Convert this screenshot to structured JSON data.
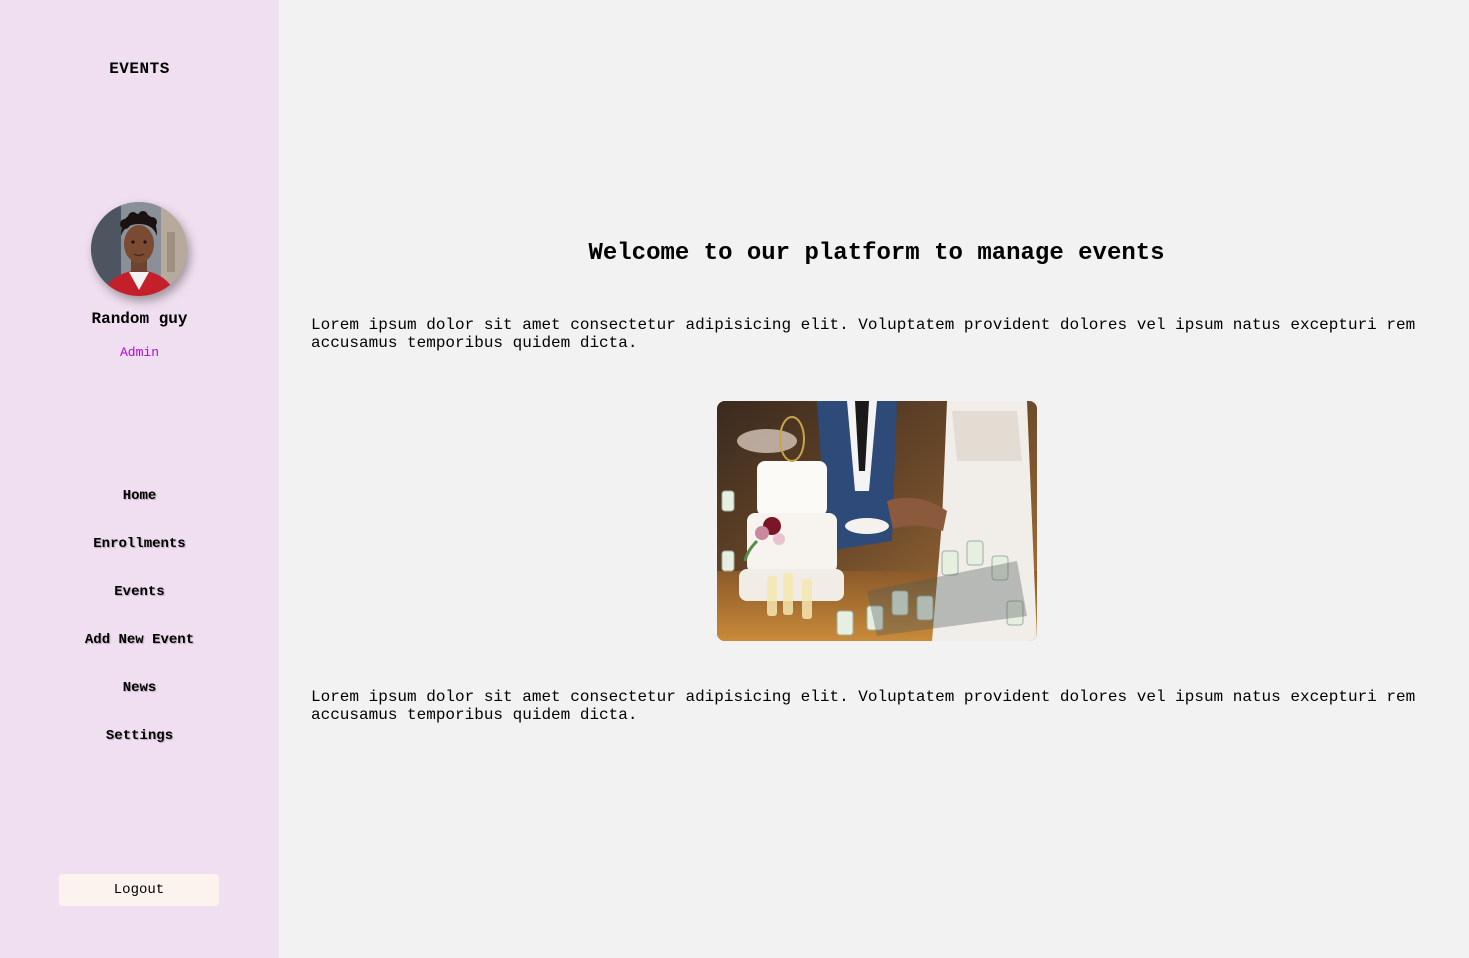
{
  "sidebar": {
    "brand": "EVENTS",
    "user": {
      "name": "Random guy",
      "role": "Admin"
    },
    "nav": [
      {
        "label": "Home"
      },
      {
        "label": "Enrollments"
      },
      {
        "label": "Events"
      },
      {
        "label": "Add New Event"
      },
      {
        "label": "News"
      },
      {
        "label": "Settings"
      }
    ],
    "logout_label": "Logout"
  },
  "main": {
    "heading": "Welcome to our platform to manage events",
    "paragraph_1": "Lorem ipsum dolor sit amet consectetur adipisicing elit. Voluptatem provident dolores vel ipsum natus excepturi rem accusamus temporibus quidem dicta.",
    "paragraph_2": "Lorem ipsum dolor sit amet consectetur adipisicing elit. Voluptatem provident dolores vel ipsum natus excepturi rem accusamus temporibus quidem dicta."
  },
  "colors": {
    "sidebar_bg": "#f0dff0",
    "main_bg": "#f2f2f2",
    "role_text": "#b400e6",
    "logout_bg": "#fdf3ee"
  }
}
